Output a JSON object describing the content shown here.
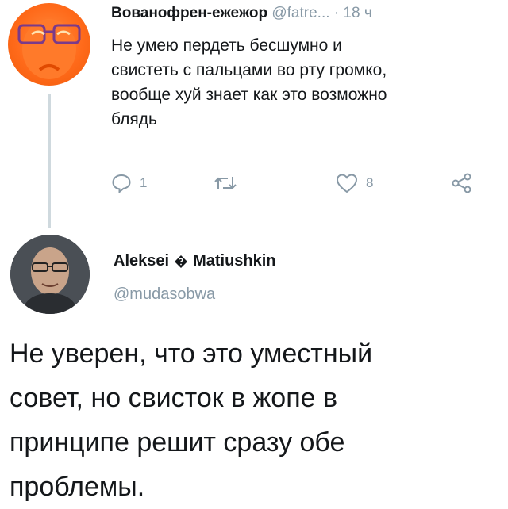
{
  "tweet1": {
    "author_name": "Вованофрен-ежежор",
    "handle": "@fatre...",
    "separator": "·",
    "time": "18 ч",
    "text_lines": [
      "Не умею пердеть бесшумно и",
      "свистеть с пальцами во рту громко,",
      "вообще хуй знает как это возможно",
      "блядь"
    ],
    "reply_count": "1",
    "retweet_count": "",
    "like_count": "8"
  },
  "tweet2": {
    "author_first": "Aleksei",
    "author_last": "Matiushkin",
    "handle": "@mudasobwa",
    "text_lines": [
      "Не уверен, что это уместный",
      "совет, но свисток в жопе в",
      "принципе решит сразу обе",
      "проблемы."
    ]
  },
  "colors": {
    "text": "#14171a",
    "secondary": "#8899a6",
    "thread_line": "#cfd9de",
    "avatar1_bg": "#ff6a1a"
  },
  "icons": [
    "reply-icon",
    "retweet-icon",
    "like-icon",
    "share-icon",
    "diamond-icon"
  ]
}
